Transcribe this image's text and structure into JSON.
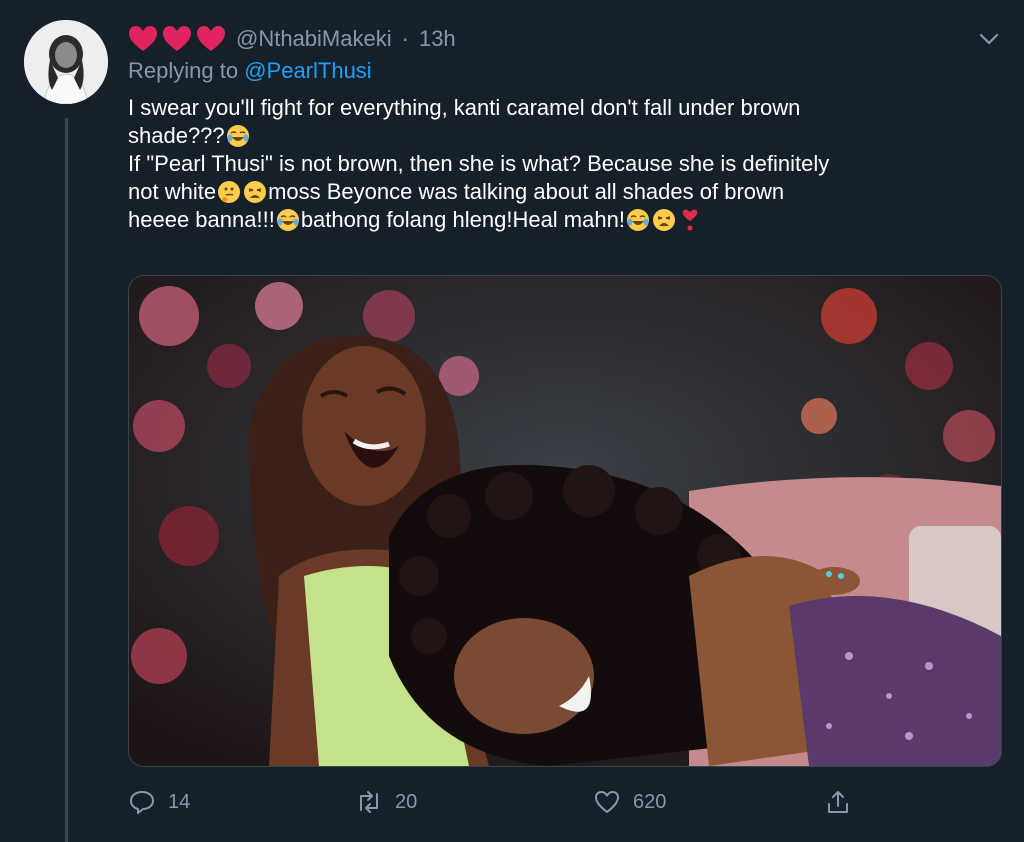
{
  "tweet": {
    "handle": "@NthabiMakeki",
    "separator": "·",
    "time": "13h",
    "replying_prefix": "Replying to",
    "replying_to": "@PearlThusi",
    "lines": {
      "l1": "I swear you'll fight for everything, kanti caramel don't fall under brown",
      "l2": "shade???",
      "l3": "If \"Pearl Thusi\" is not brown, then she is what? Because she is definitely",
      "l4a": "not white",
      "l4b": "moss Beyonce was talking about all shades of brown",
      "l5a": "heeee banna!!!",
      "l5b": "bathong folang hleng!Heal mahn!"
    },
    "name_icons": [
      "heart-icon",
      "heart-icon",
      "heart-icon"
    ],
    "media_alt": "photo-of-two-women-laughing",
    "counts": {
      "replies": "14",
      "retweets": "20",
      "likes": "620"
    }
  },
  "colors": {
    "background": "#15202b",
    "muted_text": "#8899a6",
    "link": "#1da1f2",
    "heart": "#e0245e",
    "divider": "#38444d"
  }
}
